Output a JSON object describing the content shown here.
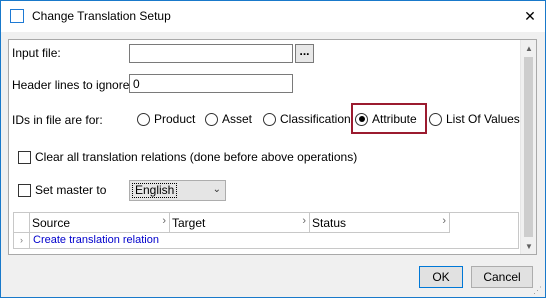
{
  "window": {
    "title": "Change Translation Setup",
    "close_glyph": "✕"
  },
  "form": {
    "input_file": {
      "label": "Input file:",
      "value": "",
      "browse_label": "..."
    },
    "header_lines": {
      "label": "Header lines to ignore",
      "value": "0"
    },
    "ids_for": {
      "label": "IDs in file are for:",
      "options": [
        {
          "label": "Product",
          "checked": false
        },
        {
          "label": "Asset",
          "checked": false
        },
        {
          "label": "Classification",
          "checked": false
        },
        {
          "label": "Attribute",
          "checked": true
        },
        {
          "label": "List Of Values",
          "checked": false
        }
      ]
    },
    "clear_relations": {
      "label": "Clear all translation relations (done before above operations)",
      "checked": false
    },
    "set_master": {
      "label": "Set master to",
      "checked": false,
      "selected": "English"
    }
  },
  "grid": {
    "columns": [
      "Source",
      "Target",
      "Status"
    ],
    "create_link": "Create translation relation"
  },
  "buttons": {
    "ok": "OK",
    "cancel": "Cancel"
  },
  "colors": {
    "highlight": "#9b1b2f",
    "link": "#0000cc",
    "accent": "#0078d7"
  },
  "icons": {
    "app": "window-icon",
    "close": "close-icon",
    "dropdown": "chevron-down-icon",
    "grip": "resize-grip-icon"
  }
}
